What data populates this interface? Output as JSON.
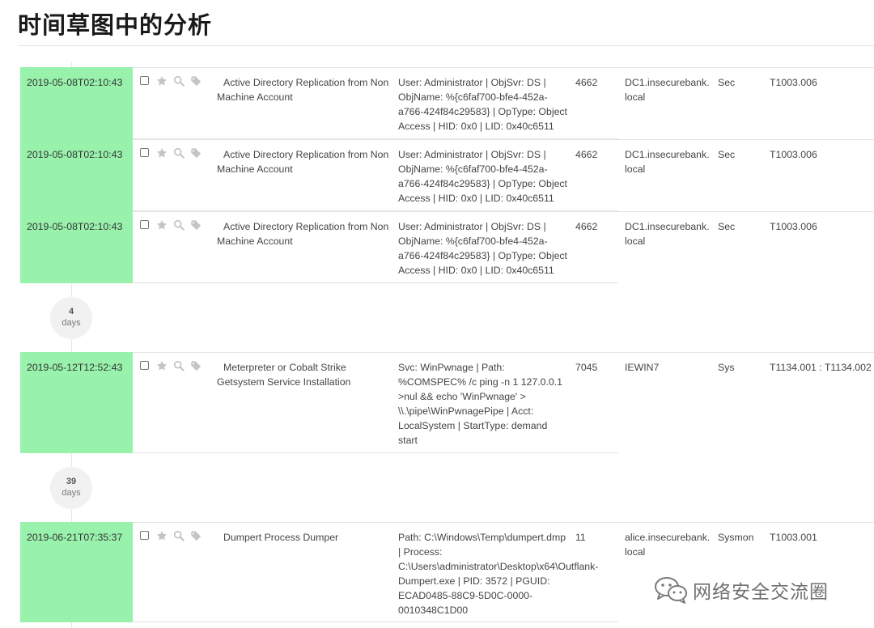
{
  "page": {
    "title": "时间草图中的分析"
  },
  "events": [
    {
      "timestamp": "2019-05-08T02:10:43",
      "rule": "Active Directory Replication from Non Machine Account",
      "details": "User: Administrator | ObjSvr: DS | ObjName: %{c6faf700-bfe4-452a-a766-424f84c29583} | OpType: Object Access | HID: 0x0 | LID: 0x40c6511",
      "event_id": "4662",
      "computer": "DC1.insecurebank.local",
      "channel": "Sec",
      "mitre": "T1003.006"
    },
    {
      "timestamp": "2019-05-08T02:10:43",
      "rule": "Active Directory Replication from Non Machine Account",
      "details": "User: Administrator | ObjSvr: DS | ObjName: %{c6faf700-bfe4-452a-a766-424f84c29583} | OpType: Object Access | HID: 0x0 | LID: 0x40c6511",
      "event_id": "4662",
      "computer": "DC1.insecurebank.local",
      "channel": "Sec",
      "mitre": "T1003.006"
    },
    {
      "timestamp": "2019-05-08T02:10:43",
      "rule": "Active Directory Replication from Non Machine Account",
      "details": "User: Administrator | ObjSvr: DS | ObjName: %{c6faf700-bfe4-452a-a766-424f84c29583} | OpType: Object Access | HID: 0x0 | LID: 0x40c6511",
      "event_id": "4662",
      "computer": "DC1.insecurebank.local",
      "channel": "Sec",
      "mitre": "T1003.006"
    },
    {
      "timestamp": "2019-05-12T12:52:43",
      "rule": "Meterpreter or Cobalt Strike Getsystem Service Installation",
      "details": "Svc: WinPwnage | Path: %COMSPEC% /c ping -n 1 127.0.0.1 >nul && echo 'WinPwnage' > \\\\.\\pipe\\WinPwnagePipe | Acct: LocalSystem | StartType: demand start",
      "event_id": "7045",
      "computer": "IEWIN7",
      "channel": "Sys",
      "mitre": "T1134.001 : T1134.002"
    },
    {
      "timestamp": "2019-06-21T07:35:37",
      "rule": "Dumpert Process Dumper",
      "details": "Path: C:\\Windows\\Temp\\dumpert.dmp | Process: C:\\Users\\administrator\\Desktop\\x64\\Outflank-Dumpert.exe | PID: 3572 | PGUID: ECAD0485-88C9-5D0C-0000-0010348C1D00",
      "event_id": "11",
      "computer": "alice.insecurebank.local",
      "channel": "Sysmon",
      "mitre": "T1003.001"
    }
  ],
  "gaps": [
    {
      "count": "4",
      "unit": "days"
    },
    {
      "count": "39",
      "unit": "days"
    }
  ],
  "row_icons": [
    "checkbox",
    "star-icon",
    "search-icon",
    "tag-icon"
  ],
  "colors": {
    "timestamp_bg": "#98f2ac",
    "gap_bubble_bg": "#f1f1f1",
    "icon_gray": "#c4c4c4"
  },
  "watermark": {
    "text": "网络安全交流圈",
    "icon": "wechat-icon"
  }
}
